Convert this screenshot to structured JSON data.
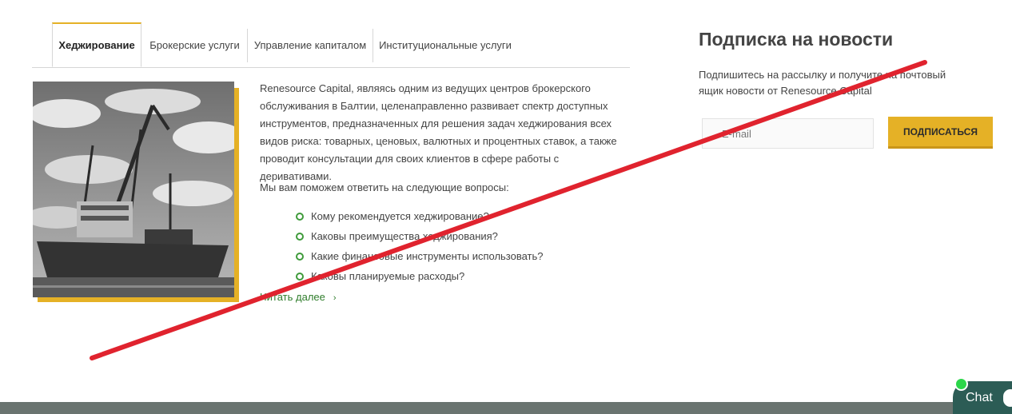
{
  "tabs": [
    {
      "label": "Хеджирование",
      "active": true
    },
    {
      "label": "Брокерские услуги",
      "active": false
    },
    {
      "label": "Управление капиталом",
      "active": false
    },
    {
      "label": "Институциональные услуги",
      "active": false
    }
  ],
  "main": {
    "description": "Renesource Capital, являясь одним из ведущих центров брокерского обслуживания в Балтии, целенаправленно развивает спектр доступных инструментов, предназначенных для решения задач хеджирования всех видов риска: товарных, ценовых, валютных и процентных ставок, а также проводит консультации для своих клиентов в сфере работы с деривативами.",
    "questions_lead": "Мы вам поможем ответить на следующие вопросы:",
    "questions": [
      "Кому рекомендуется хеджирование?",
      "Каковы преимущества хеджирования?",
      "Какие финансовые инструменты использовать?",
      "Каковы планируемые расходы?"
    ],
    "read_more": "Читать далее"
  },
  "subscribe": {
    "title": "Подписка на новости",
    "description": "Подпишитесь на рассылку и получите на почтовый ящик новости от Renesource Capital",
    "email_placeholder": "E-mail",
    "button_label": "ПОДПИСАТЬСЯ"
  },
  "chat": {
    "label": "Chat"
  },
  "colors": {
    "accent_gold": "#e5b126",
    "bullet_green": "#3f9b3b",
    "link_green": "#2f7d2b",
    "strike_red": "#e0232e",
    "footer": "#6a7470",
    "chat_bg": "#2c5c55"
  },
  "icons": {
    "bullet": "circle-bullet-icon",
    "read_more": "chevron-right-icon",
    "chat": "chat-bubble-icon",
    "online": "online-status-dot"
  }
}
